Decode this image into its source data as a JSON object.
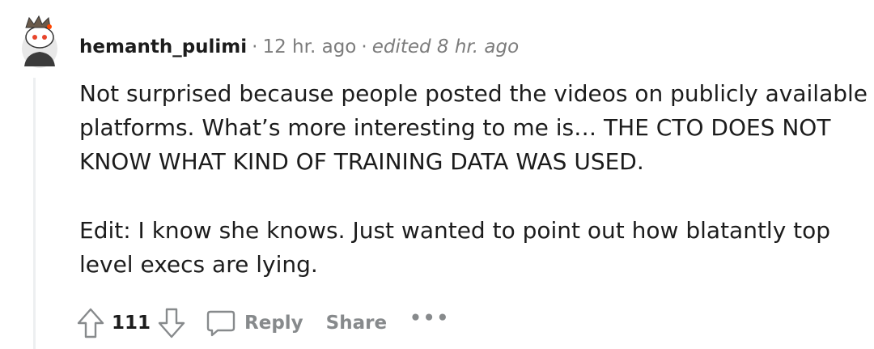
{
  "comment": {
    "author": "hemanth_pulimi",
    "separator": "·",
    "time": "12 hr. ago",
    "edited": "edited 8 hr. ago",
    "paragraphs": [
      "Not surprised because people posted the videos on publicly available platforms. What’s more interesting to me is… THE CTO DOES NOT KNOW WHAT KIND OF TRAINING DATA WAS USED.",
      "Edit: I know she knows. Just wanted to point out how blatantly top level execs are lying."
    ]
  },
  "actions": {
    "upvote_icon": "upvote-arrow-icon",
    "score": "111",
    "downvote_icon": "downvote-arrow-icon",
    "reply_icon": "chat-bubble-icon",
    "reply_label": "Reply",
    "share_label": "Share",
    "more_label": "•••"
  },
  "colors": {
    "text": "#1c1c1c",
    "muted": "#7c7c7c",
    "action": "#878a8c",
    "thread_line": "#edeff1"
  }
}
